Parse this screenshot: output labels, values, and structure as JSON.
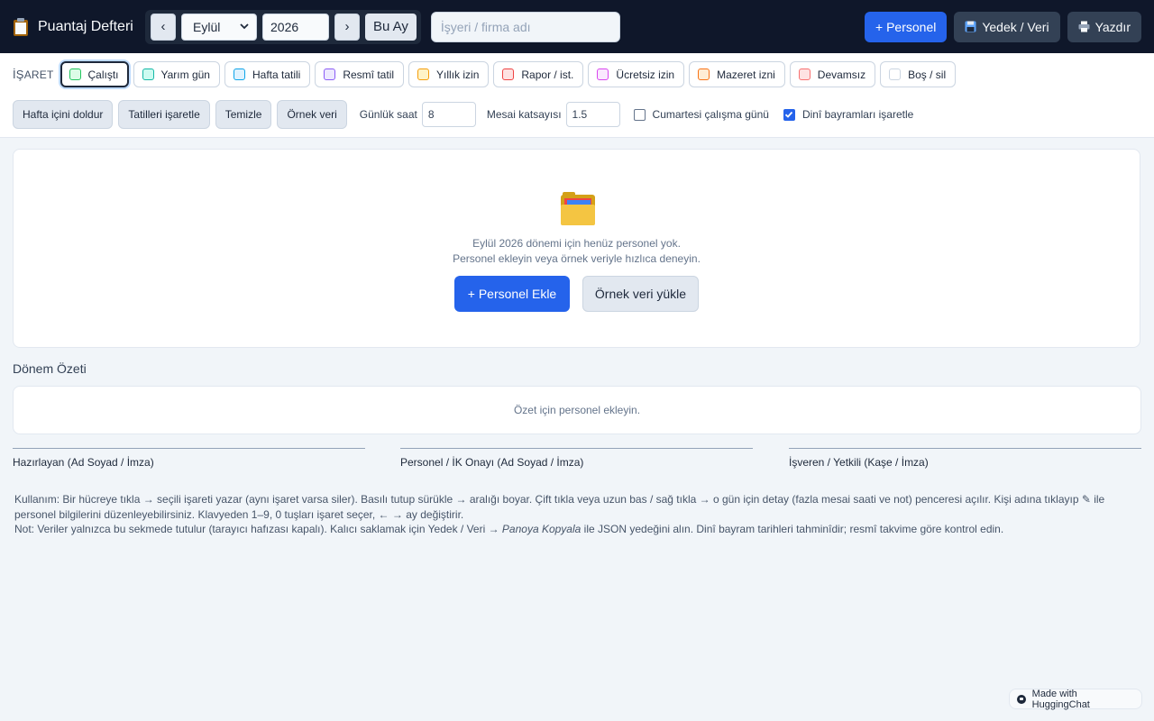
{
  "app": {
    "title": "Puantaj Defteri",
    "icon": "clipboard-icon"
  },
  "nav": {
    "prev_label": "‹",
    "next_label": "›",
    "month_value": "Eylül",
    "year_value": "2026",
    "today_label": "Bu Ay"
  },
  "company": {
    "placeholder": "İşyeri / firma adı"
  },
  "topbar": {
    "add_person_label": "+ Personel",
    "backup_label": "Yedek / Veri",
    "backup_icon": "floppy-disk-icon",
    "print_label": "Yazdır",
    "print_icon": "printer-icon"
  },
  "marker": {
    "label": "İşaret",
    "selected": "Çalıştı",
    "items": [
      {
        "label": "Çalıştı",
        "bg": "#dcfce7",
        "border": "#22c55e"
      },
      {
        "label": "Yarım gün",
        "bg": "#ccfbf1",
        "border": "#14b8a6"
      },
      {
        "label": "Hafta tatili",
        "bg": "#e0f2fe",
        "border": "#0ea5e9"
      },
      {
        "label": "Resmî tatil",
        "bg": "#ede9fe",
        "border": "#8b5cf6"
      },
      {
        "label": "Yıllık izin",
        "bg": "#fef3c7",
        "border": "#f59e0b"
      },
      {
        "label": "Rapor / ist.",
        "bg": "#fee2e2",
        "border": "#ef4444"
      },
      {
        "label": "Ücretsiz izin",
        "bg": "#fae8ff",
        "border": "#d946ef"
      },
      {
        "label": "Mazeret izni",
        "bg": "#ffedd5",
        "border": "#f97316"
      },
      {
        "label": "Devamsız",
        "bg": "#fee2e2",
        "border": "#f87171"
      },
      {
        "label": "Boş / sil",
        "bg": "#ffffff",
        "border": "#cbd5e1"
      }
    ]
  },
  "actions": {
    "fill_weekdays": "Hafta içini doldur",
    "mark_holidays": "Tatilleri işaretle",
    "clear": "Temizle",
    "sample": "Örnek veri"
  },
  "settings": {
    "daily_hours_label": "Günlük saat",
    "daily_hours_value": "8",
    "overtime_label": "Mesai katsayısı",
    "overtime_value": "1.5",
    "saturday_label": "Cumartesi çalışma günü",
    "saturday_checked": false,
    "religious_label": "Dinî bayramları işaretle",
    "religious_checked": true
  },
  "empty": {
    "icon": "folder-icon",
    "line1": "Eylül 2026 dönemi için henüz personel yok.",
    "line2": "Personel ekleyin veya örnek veriyle hızlıca deneyin.",
    "add_label": "+ Personel Ekle",
    "sample_label": "Örnek veri yükle"
  },
  "summary": {
    "title": "Dönem Özeti",
    "empty_text": "Özet için personel ekleyin."
  },
  "signatures": [
    "Hazırlayan (Ad Soyad / İmza)",
    "Personel / İK Onayı (Ad Soyad / İmza)",
    "İşveren / Yetkili (Kaşe / İmza)"
  ],
  "help": {
    "usage": "Kullanım: Bir hücreye tıkla → seçili işareti yazar (aynı işaret varsa siler). Basılı tutup sürükle → aralığı boyar. Çift tıkla veya uzun bas / sağ tıkla → o gün için detay (fazla mesai saati ve not) penceresi açılır. Kişi adına tıklayıp ✎ ile personel bilgilerini düzenleyebilirsiniz. Klavyeden 1–9, 0 tuşları işaret seçer, ← → ay değiştirir.",
    "note_prefix": "Not: Veriler yalnızca bu sekmede tutulur (tarayıcı hafızası kapalı). Kalıcı saklamak için Yedek / Veri → ",
    "note_italic": "Panoya Kopyala",
    "note_suffix": " ile JSON yedeğini alın. Dinî bayram tarihleri tahminîdir; resmî takvime göre kontrol edin."
  },
  "badge": {
    "label": "Made with HuggingChat"
  }
}
